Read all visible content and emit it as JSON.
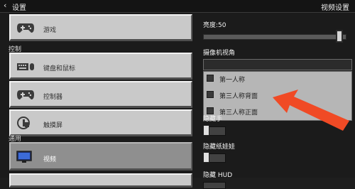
{
  "topbar": {
    "back_label": "设置",
    "title": "视频设置"
  },
  "left": {
    "items": [
      {
        "label": "游戏",
        "icon": "gamepad-icon"
      },
      {
        "label": "键盘和鼠标",
        "icon": "keyboard-mouse-icon"
      },
      {
        "label": "控制器",
        "icon": "controller-icon"
      },
      {
        "label": "触摸屏",
        "icon": "touch-hand-icon"
      },
      {
        "label": "视频",
        "icon": "monitor-icon"
      }
    ],
    "sections": {
      "controls": "控制",
      "general": "通用"
    }
  },
  "right": {
    "brightness_label": "亮度:50",
    "brightness_value": 50,
    "camera_label": "摄像机视角",
    "camera_options": [
      {
        "label": "第一人称"
      },
      {
        "label": "第三人称背面"
      },
      {
        "label": "第三人称正面"
      }
    ],
    "hide_hand_label": "隐藏手",
    "hide_paperdoll_label": "隐藏纸娃娃",
    "hide_hud_label": "隐藏 HUD"
  },
  "colors": {
    "arrow": "#f04a25",
    "button_bg": "#c9c9c9",
    "selected_bg": "#8f8f8f"
  }
}
